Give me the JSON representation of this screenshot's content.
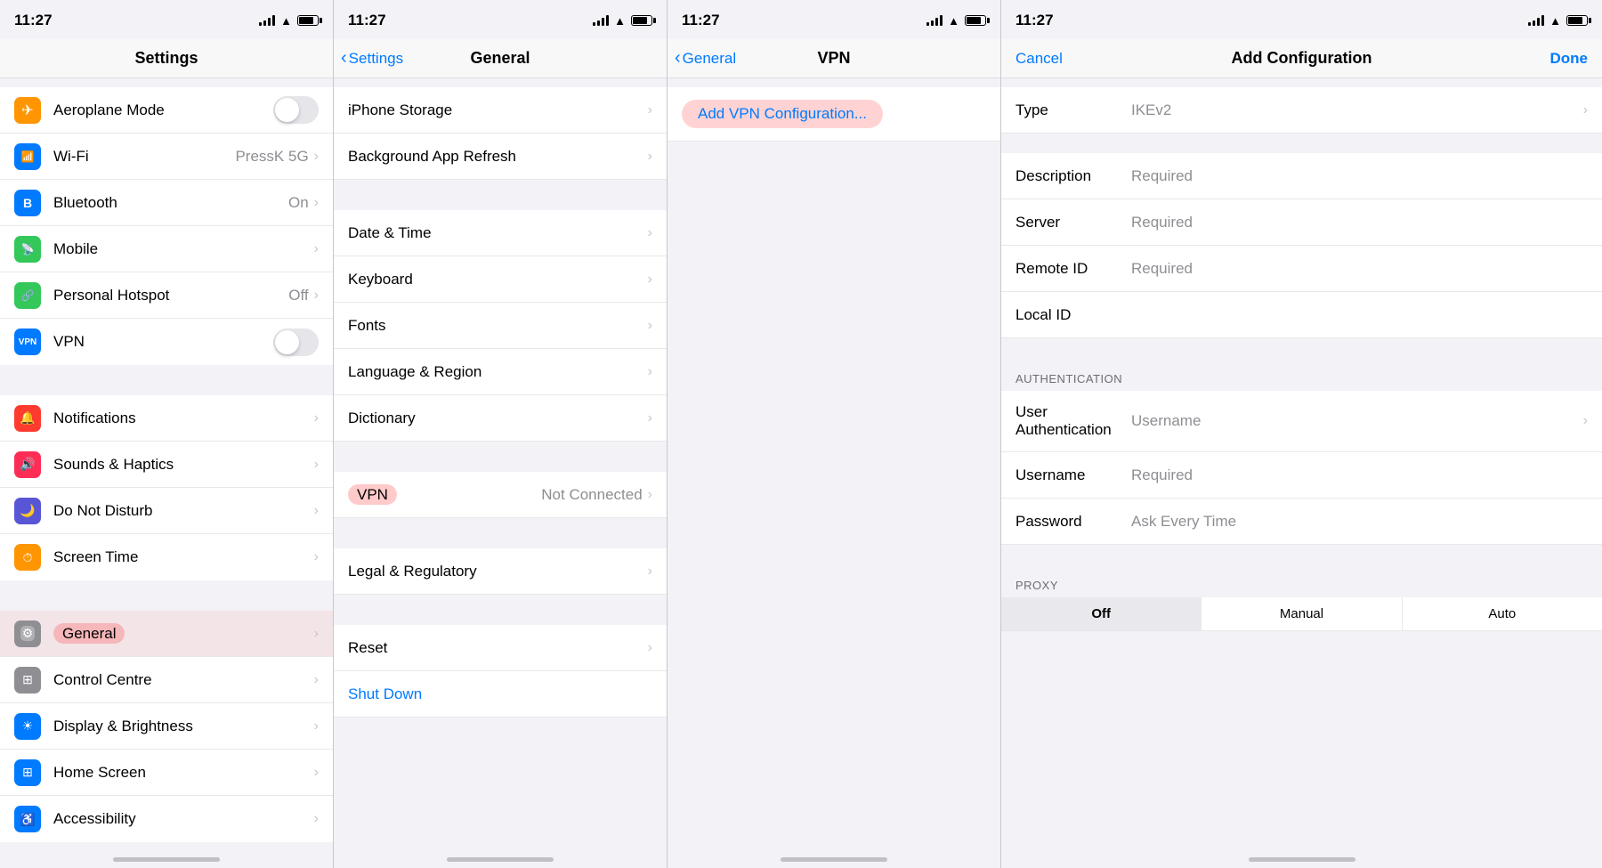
{
  "panels": {
    "settings": {
      "title": "Settings",
      "time": "11:27",
      "rows": [
        {
          "id": "airplane",
          "label": "Aeroplane Mode",
          "icon": "✈",
          "iconClass": "icon-airplane",
          "type": "toggle",
          "toggleOn": false
        },
        {
          "id": "wifi",
          "label": "Wi-Fi",
          "icon": "📶",
          "iconClass": "icon-wifi",
          "type": "chevron",
          "value": "PressK 5G"
        },
        {
          "id": "bluetooth",
          "label": "Bluetooth",
          "icon": "B",
          "iconClass": "icon-bluetooth",
          "type": "chevron",
          "value": "On"
        },
        {
          "id": "mobile",
          "label": "Mobile",
          "icon": "📡",
          "iconClass": "icon-mobile",
          "type": "chevron",
          "value": ""
        },
        {
          "id": "hotspot",
          "label": "Personal Hotspot",
          "icon": "🔗",
          "iconClass": "icon-hotspot",
          "type": "chevron",
          "value": "Off"
        },
        {
          "id": "vpn",
          "label": "VPN",
          "icon": "VPN",
          "iconClass": "icon-vpn",
          "type": "toggle",
          "toggleOn": false
        }
      ],
      "rows2": [
        {
          "id": "notifications",
          "label": "Notifications",
          "icon": "🔔",
          "iconClass": "icon-notifications",
          "type": "chevron"
        },
        {
          "id": "sounds",
          "label": "Sounds & Haptics",
          "icon": "🔊",
          "iconClass": "icon-sounds",
          "type": "chevron"
        },
        {
          "id": "dnd",
          "label": "Do Not Disturb",
          "icon": "🌙",
          "iconClass": "icon-dnd",
          "type": "chevron"
        },
        {
          "id": "screentime",
          "label": "Screen Time",
          "icon": "⏱",
          "iconClass": "icon-screentime",
          "type": "chevron"
        }
      ],
      "rows3": [
        {
          "id": "general",
          "label": "General",
          "icon": "⚙",
          "iconClass": "icon-general",
          "type": "chevron",
          "highlighted": true
        },
        {
          "id": "controlcentre",
          "label": "Control Centre",
          "icon": "⊞",
          "iconClass": "icon-controlcentre",
          "type": "chevron"
        },
        {
          "id": "brightness",
          "label": "Display & Brightness",
          "icon": "☀",
          "iconClass": "icon-brightness",
          "type": "chevron"
        },
        {
          "id": "homescreen",
          "label": "Home Screen",
          "icon": "⊞",
          "iconClass": "icon-homescreen",
          "type": "chevron"
        },
        {
          "id": "accessibility",
          "label": "Accessibility",
          "icon": "♿",
          "iconClass": "icon-accessibility",
          "type": "chevron"
        }
      ]
    },
    "general": {
      "title": "General",
      "backLabel": "Settings",
      "time": "11:27",
      "rows": [
        {
          "id": "iphone-storage",
          "label": "iPhone Storage",
          "type": "chevron"
        },
        {
          "id": "bg-refresh",
          "label": "Background App Refresh",
          "type": "chevron"
        }
      ],
      "rows2": [
        {
          "id": "datetime",
          "label": "Date & Time",
          "type": "chevron"
        },
        {
          "id": "keyboard",
          "label": "Keyboard",
          "type": "chevron"
        },
        {
          "id": "fonts",
          "label": "Fonts",
          "type": "chevron"
        },
        {
          "id": "language",
          "label": "Language & Region",
          "type": "chevron"
        },
        {
          "id": "dictionary",
          "label": "Dictionary",
          "type": "chevron"
        }
      ],
      "rows3": [
        {
          "id": "vpn",
          "label": "VPN",
          "value": "Not Connected",
          "type": "chevron",
          "highlighted": true
        }
      ],
      "rows4": [
        {
          "id": "legal",
          "label": "Legal & Regulatory",
          "type": "chevron"
        }
      ],
      "rows5": [
        {
          "id": "reset",
          "label": "Reset",
          "type": "chevron"
        },
        {
          "id": "shutdown",
          "label": "Shut Down",
          "type": "shutdown"
        }
      ]
    },
    "vpn": {
      "title": "VPN",
      "backLabel": "General",
      "time": "11:27",
      "addLabel": "Add VPN Configuration..."
    },
    "addConfig": {
      "title": "Add Configuration",
      "cancelLabel": "Cancel",
      "doneLabel": "Done",
      "time": "11:27",
      "typeRow": {
        "label": "Type",
        "value": "IKEv2"
      },
      "fields": [
        {
          "label": "Description",
          "placeholder": "Required"
        },
        {
          "label": "Server",
          "placeholder": "Required"
        },
        {
          "label": "Remote ID",
          "placeholder": "Required"
        },
        {
          "label": "Local ID",
          "placeholder": ""
        }
      ],
      "authSection": "AUTHENTICATION",
      "authRows": [
        {
          "label": "User Authentication",
          "value": "Username"
        },
        {
          "label": "Username",
          "placeholder": "Required"
        },
        {
          "label": "Password",
          "placeholder": "Ask Every Time"
        }
      ],
      "proxySection": "PROXY",
      "proxyOptions": [
        "Off",
        "Manual",
        "Auto"
      ],
      "selectedProxy": "Off"
    }
  }
}
